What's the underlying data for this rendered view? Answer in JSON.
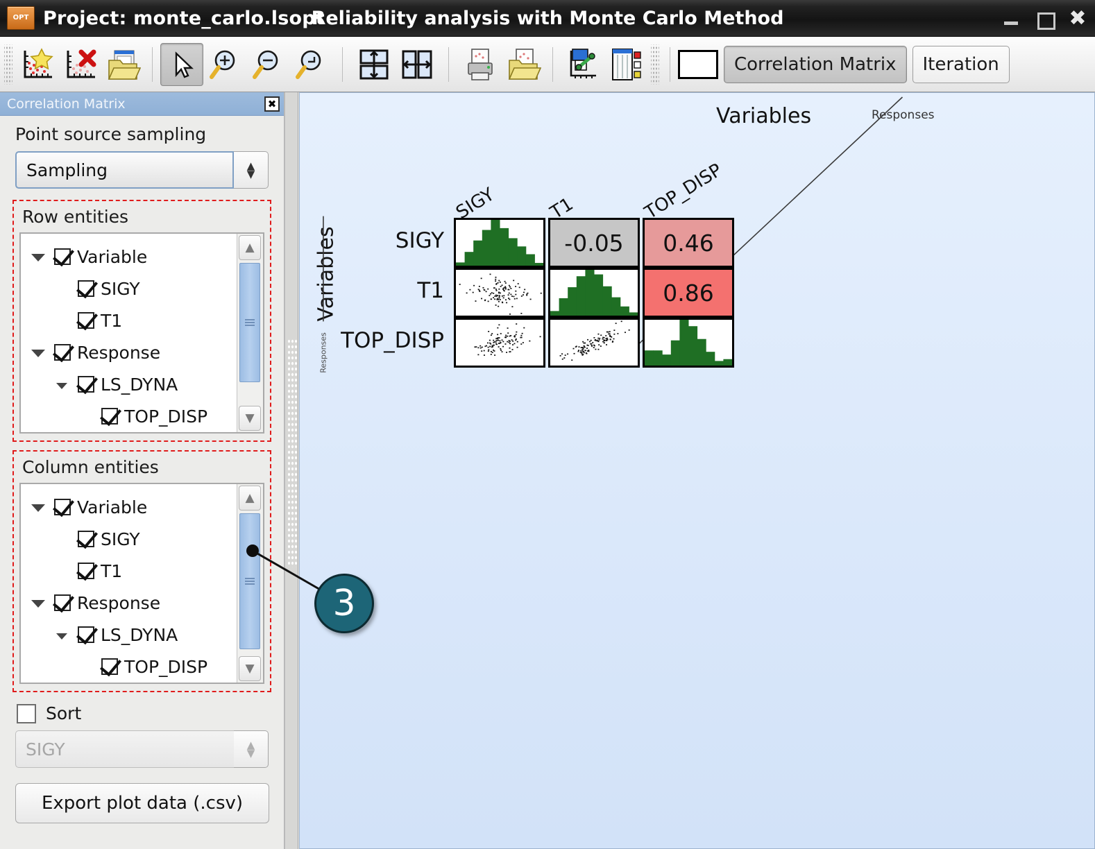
{
  "window": {
    "project_label": "Project: monte_carlo.lsopt",
    "title": "Reliability analysis with Monte Carlo Method",
    "logo_text": "OPT",
    "minimize": "–",
    "maximize": "□",
    "close": "✕"
  },
  "toolbar": {
    "buttons": [
      {
        "name": "new-plot-icon",
        "tip": "New plot"
      },
      {
        "name": "delete-plot-icon",
        "tip": "Delete plot"
      },
      {
        "name": "open-plot-icon",
        "tip": "Open plot"
      },
      {
        "name": "pointer-icon",
        "tip": "Select"
      },
      {
        "name": "zoom-in-icon",
        "tip": "Zoom in"
      },
      {
        "name": "zoom-out-icon",
        "tip": "Zoom out"
      },
      {
        "name": "zoom-reset-icon",
        "tip": "Reset zoom"
      },
      {
        "name": "split-horizontal-icon",
        "tip": "Split horizontally"
      },
      {
        "name": "split-vertical-icon",
        "tip": "Split vertically"
      },
      {
        "name": "print-icon",
        "tip": "Print"
      },
      {
        "name": "save-plot-icon",
        "tip": "Save plot"
      },
      {
        "name": "scatter-setup-icon",
        "tip": "Scatter setup"
      },
      {
        "name": "columns-setup-icon",
        "tip": "Column setup"
      }
    ],
    "tabs": [
      {
        "label": "Correlation Matrix",
        "active": true
      },
      {
        "label": "Iteration",
        "active": false
      }
    ]
  },
  "sidebar": {
    "panel_title": "Correlation Matrix",
    "close_glyph": "✖",
    "point_source_label": "Point source sampling",
    "point_source_value": "Sampling",
    "row_entities_label": "Row entities",
    "column_entities_label": "Column entities",
    "tree": [
      {
        "label": "Variable",
        "indent": 0,
        "caret": true,
        "checked": true
      },
      {
        "label": "SIGY",
        "indent": 1,
        "caret": false,
        "checked": true
      },
      {
        "label": "T1",
        "indent": 1,
        "caret": false,
        "checked": true
      },
      {
        "label": "Response",
        "indent": 0,
        "caret": true,
        "checked": true
      },
      {
        "label": "LS_DYNA",
        "indent": 1,
        "caret": true,
        "checked": true
      },
      {
        "label": "TOP_DISP",
        "indent": 2,
        "caret": false,
        "checked": true
      }
    ],
    "sort_label": "Sort",
    "sort_checked": false,
    "sort_value": "SIGY",
    "export_label": "Export plot data (.csv)"
  },
  "annotation": {
    "number": "3"
  },
  "chart_data": {
    "type": "heatmap",
    "title": "Correlation Matrix",
    "top_axis_group_primary": "Variables",
    "top_axis_group_secondary": "Responses",
    "left_axis_group_primary": "Variables",
    "left_axis_group_secondary": "Responses",
    "row_labels": [
      "SIGY",
      "T1",
      "TOP_DISP"
    ],
    "col_labels": [
      "SIGY",
      "T1",
      "TOP_DISP"
    ],
    "cells": [
      [
        {
          "kind": "histogram",
          "value": null
        },
        {
          "kind": "correlation",
          "value": "-0.05",
          "color": "#c6c6c6"
        },
        {
          "kind": "correlation",
          "value": "0.46",
          "color": "#e69a9a"
        }
      ],
      [
        {
          "kind": "scatter",
          "value": null
        },
        {
          "kind": "histogram",
          "value": null
        },
        {
          "kind": "correlation",
          "value": "0.86",
          "color": "#f4716f"
        }
      ],
      [
        {
          "kind": "scatter",
          "value": null
        },
        {
          "kind": "scatter",
          "value": null
        },
        {
          "kind": "histogram",
          "value": null
        }
      ]
    ],
    "correlations": {
      "SIGY_T1": -0.05,
      "SIGY_TOP_DISP": 0.46,
      "T1_TOP_DISP": 0.86
    },
    "histograms": {
      "SIGY": [
        0.07,
        0.3,
        0.55,
        0.78,
        1.0,
        0.82,
        0.6,
        0.42,
        0.25,
        0.06
      ],
      "T1": [
        0.1,
        0.38,
        0.62,
        0.86,
        1.0,
        0.9,
        0.64,
        0.4,
        0.2,
        0.07
      ],
      "TOP_DISP": [
        0.33,
        0.33,
        0.24,
        0.55,
        1.0,
        0.86,
        0.58,
        0.3,
        0.1,
        0.14
      ]
    },
    "legend_position": "none",
    "grid": false,
    "colors": {
      "histogram_fill": "#1f6f24",
      "cell_border": "#000000",
      "plot_background": "#e6f0fd",
      "neutral": "#c6c6c6",
      "moderate_positive": "#e69a9a",
      "strong_positive": "#f4716f",
      "accent_callout": "#1d6577"
    }
  }
}
